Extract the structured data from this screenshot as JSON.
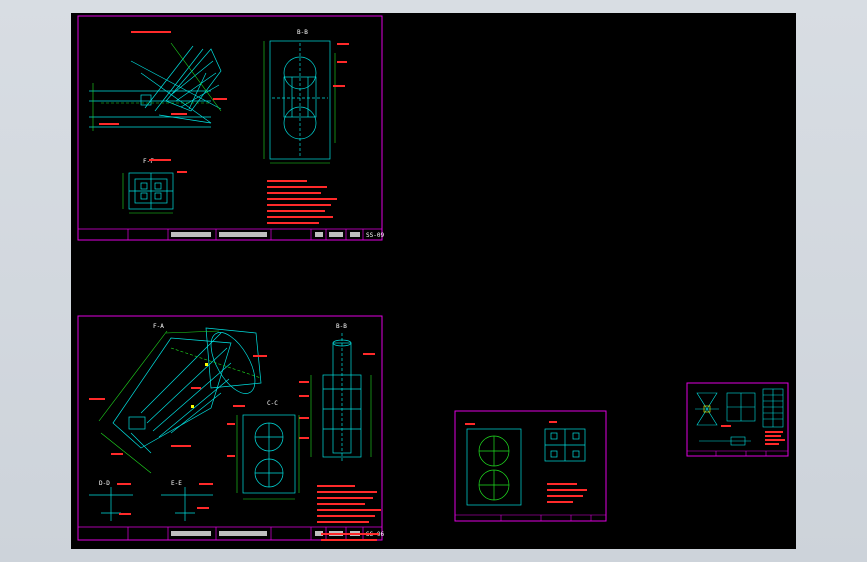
{
  "colors": {
    "background": "#000000",
    "chrome": "#d3d8de",
    "frame": "#e000e0",
    "geometry": "#00e0e0",
    "dimension": "#20e020",
    "notes": "#ff2a2a",
    "titleblock_text": "#ffffff",
    "weld": "#ffff00"
  },
  "sheets": [
    {
      "id": "sheet-1",
      "section_labels": [
        "B-B",
        "F-F"
      ],
      "title_cells": [
        "SS-09"
      ]
    },
    {
      "id": "sheet-2",
      "section_labels": [
        "F-A",
        "B-B",
        "C-C",
        "D-D",
        "E-E"
      ],
      "title_cells": [
        "SS-06"
      ]
    },
    {
      "id": "sheet-3",
      "section_labels": [],
      "title_cells": []
    },
    {
      "id": "sheet-4",
      "section_labels": [],
      "title_cells": []
    }
  ]
}
